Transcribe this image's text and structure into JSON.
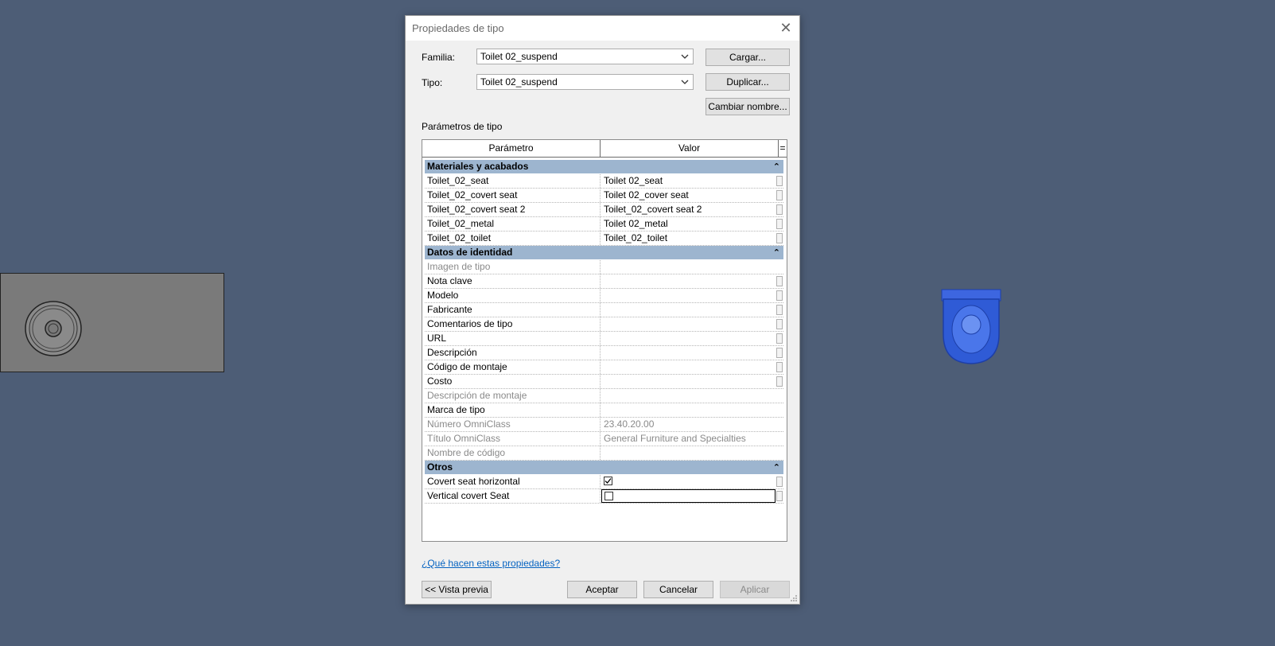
{
  "dialog": {
    "title": "Propiedades de tipo",
    "familia_label": "Familia:",
    "familia_value": "Toilet 02_suspend",
    "tipo_label": "Tipo:",
    "tipo_value": "Toilet 02_suspend",
    "cargar_button": "Cargar...",
    "duplicar_button": "Duplicar...",
    "cambiar_nombre_button": "Cambiar nombre...",
    "section_label": "Parámetros de tipo",
    "grid": {
      "col_param": "Parámetro",
      "col_valor": "Valor",
      "col_extra": "=",
      "groups": [
        {
          "name": "Materiales y acabados",
          "rows": [
            {
              "param": "Toilet_02_seat",
              "value": "Toilet 02_seat"
            },
            {
              "param": "Toilet_02_covert seat",
              "value": "Toilet 02_cover seat"
            },
            {
              "param": "Toilet_02_covert seat 2",
              "value": "Toilet_02_covert seat 2"
            },
            {
              "param": "Toilet_02_metal",
              "value": "Toilet 02_metal"
            },
            {
              "param": "Toilet_02_toilet",
              "value": "Toilet_02_toilet"
            }
          ]
        },
        {
          "name": "Datos de identidad",
          "rows": [
            {
              "param": "Imagen de tipo",
              "value": ""
            },
            {
              "param": "Nota clave",
              "value": ""
            },
            {
              "param": "Modelo",
              "value": ""
            },
            {
              "param": "Fabricante",
              "value": ""
            },
            {
              "param": "Comentarios de tipo",
              "value": ""
            },
            {
              "param": "URL",
              "value": ""
            },
            {
              "param": "Descripción",
              "value": ""
            },
            {
              "param": "Código de montaje",
              "value": ""
            },
            {
              "param": "Costo",
              "value": ""
            },
            {
              "param": "Descripción de montaje",
              "value": ""
            },
            {
              "param": "Marca de tipo",
              "value": ""
            },
            {
              "param": "Número OmniClass",
              "value": "23.40.20.00"
            },
            {
              "param": "Título OmniClass",
              "value": "General Furniture and Specialties"
            },
            {
              "param": "Nombre de código",
              "value": ""
            }
          ]
        },
        {
          "name": "Otros",
          "rows": [
            {
              "param": "Covert seat horizontal",
              "checked": true
            },
            {
              "param": "Vertical covert Seat",
              "checked": false
            }
          ]
        }
      ]
    },
    "help_link": "¿Qué hacen estas propiedades?",
    "vista_previa_button": "<< Vista previa",
    "aceptar_button": "Aceptar",
    "cancelar_button": "Cancelar",
    "aplicar_button": "Aplicar"
  },
  "colors": {
    "background": "#4d5d76",
    "group_header": "#9db5cf",
    "link": "#0563c1",
    "object_blue": "#2f5bd6"
  }
}
